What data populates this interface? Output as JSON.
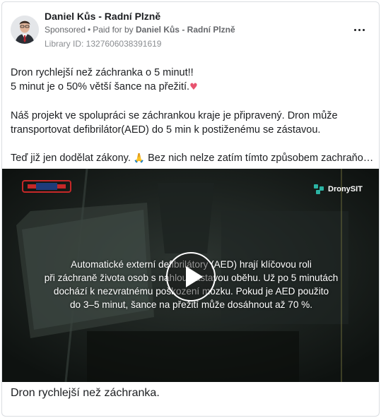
{
  "header": {
    "page_name": "Daniel Kůs - Radní Plzně",
    "sponsored_label": "Sponsored",
    "paid_for_prefix": "Paid for by",
    "paid_for_name": "Daniel Kůs - Radní Plzně",
    "library_id": "Library ID: 1327606038391619"
  },
  "post": {
    "line1": "Dron rychlejší než záchranka o 5 minut!!",
    "line2": "5 minut je o 50% větší šance na přežití.",
    "line2_emoji": "♥",
    "line3": "Náš projekt ve spolupráci se záchrankou kraje je připravený. Dron může",
    "line4": "transportovat defibrilátor(AED) do 5 min k postiženému se zástavou.",
    "line5_before": "Teď již jen dodělat zákony.",
    "line5_emoji": "🙏",
    "line5_after": "Bez nich nelze zatím tímto způsobem zachraňovat…"
  },
  "video": {
    "brand_right": "DronySIT",
    "caption_lines": [
      "Automatické externí defibrilátory (AED) hrají klíčovou roli",
      "při záchraně života osob s náhlou zástavou oběhu. Už po 5 minutách",
      "dochází k nezvratnému poškození mozku. Pokud je AED použito",
      "do 3–5 minut, šance na přežití může dosáhnout až 70 %."
    ]
  },
  "footer": {
    "title": "Dron rychlejší než záchranka."
  },
  "colors": {
    "text": "#1c1e21",
    "secondary": "#65676b",
    "heart": "#e8536f",
    "video_bg": "#151b18"
  }
}
